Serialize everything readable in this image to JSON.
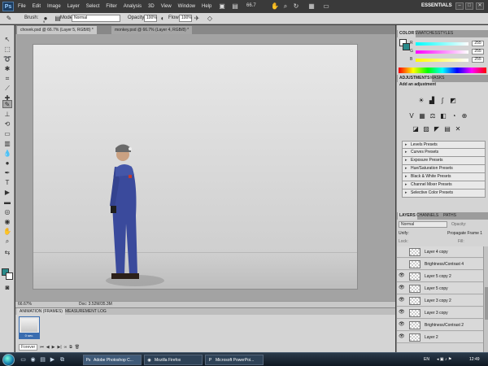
{
  "app": {
    "logo": "Ps",
    "menu": [
      "File",
      "Edit",
      "Image",
      "Layer",
      "Select",
      "Filter",
      "Analysis",
      "3D",
      "View",
      "Window",
      "Help"
    ],
    "zoom": "66.7",
    "workspace": "ESSENTIALS",
    "window_buttons": [
      "–",
      "□",
      "✕"
    ]
  },
  "options": {
    "brush_label": "Brush:",
    "brush_size": "9",
    "mode_label": "Mode:",
    "mode_value": "Normal",
    "opacity_label": "Opacity:",
    "opacity_value": "100%",
    "flow_label": "Flow:",
    "flow_value": "100%"
  },
  "documents": {
    "tabs": [
      "chovek.psd @ 66.7% (Layer 5, RGB/8) *",
      "monkey.psd @ 66.7% (Layer 4, RGB/8) *"
    ]
  },
  "status": {
    "zoom": "66.67%",
    "doc": "Doc: 3.52M/35.3M"
  },
  "animation": {
    "tabs": [
      "ANIMATION (FRAMES)",
      "MEASUREMENT LOG"
    ],
    "frame_time": "0 sec.",
    "loop": "Forever"
  },
  "color_panel": {
    "tabs": [
      "COLOR",
      "SWATCHES",
      "STYLES"
    ],
    "channels": [
      {
        "name": "R",
        "value": "255"
      },
      {
        "name": "G",
        "value": "255"
      },
      {
        "name": "B",
        "value": "255"
      }
    ]
  },
  "adjustments": {
    "tabs": [
      "ADJUSTMENTS",
      "MASKS"
    ],
    "title": "Add an adjustment",
    "presets": [
      "Levels Presets",
      "Curves Presets",
      "Exposure Presets",
      "Hue/Saturation Presets",
      "Black & White Presets",
      "Channel Mixer Presets",
      "Selective Color Presets"
    ]
  },
  "layers": {
    "tabs": [
      "LAYERS",
      "CHANNELS",
      "PATHS"
    ],
    "blend_mode": "Normal",
    "opacity_label": "Opacity:",
    "unify_label": "Unify:",
    "propagate_label": "Propagate Frame 1",
    "lock_label": "Lock:",
    "fill_label": "Fill:",
    "items": [
      "Layer 4 copy",
      "Brightness/Contrast 4",
      "Layer 5 copy 2",
      "Layer 5 copy",
      "Layer 3 copy 2",
      "Layer 3 copy",
      "Brightness/Contrast 2",
      "Layer 2"
    ]
  },
  "taskbar": {
    "tasks": [
      "Adobe Photoshop C...",
      "Mozilla Firefox",
      "Microsoft PowerPoi..."
    ],
    "lang": "EN",
    "time": "12:49"
  }
}
